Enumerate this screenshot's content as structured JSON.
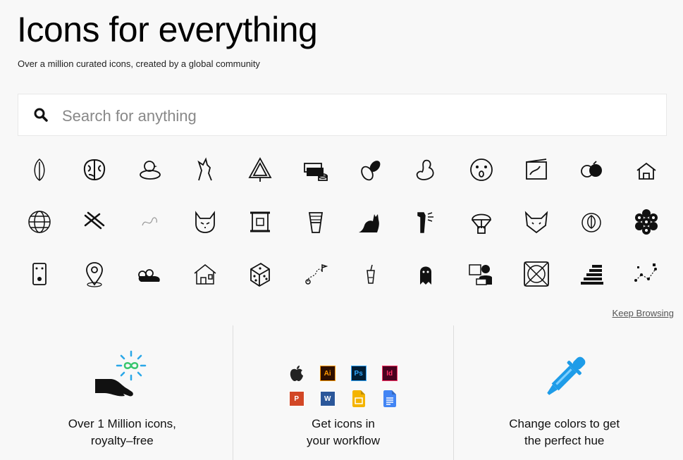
{
  "hero": {
    "title": "Icons for everything",
    "subtitle": "Over a million curated icons, created by a global community"
  },
  "search": {
    "placeholder": "Search for anything",
    "value": ""
  },
  "icon_grid": [
    "leaf-icon",
    "brain-icon",
    "bird-in-nest-icon",
    "wolf-howling-icon",
    "pine-tree-icon",
    "money-stack-icon",
    "cocoa-beans-icon",
    "peanut-icon",
    "surprised-face-icon",
    "drawing-frame-icon",
    "fruit-icon",
    "house-network-icon",
    "globe-icon",
    "nails-icon",
    "scribble-icon",
    "cat-face-icon",
    "scroll-icon",
    "djembe-drum-icon",
    "black-cat-icon",
    "shower-icon",
    "parachute-box-icon",
    "fox-head-icon",
    "leaf-badge-icon",
    "raspberry-icon",
    "effects-pedal-icon",
    "map-pin-icon",
    "roller-skate-icon",
    "house-icon",
    "dice-icon",
    "route-flag-icon",
    "iced-drink-icon",
    "ghost-icon",
    "person-at-laptop-icon",
    "no-signal-square-icon",
    "stairs-icon",
    "dotted-map-icon"
  ],
  "keep_browsing": "Keep Browsing",
  "features": [
    {
      "title": "Over 1 Million icons,\nroyalty–free"
    },
    {
      "title": "Get icons in\nyour workflow"
    },
    {
      "title": "Change colors to get\nthe perfect hue"
    }
  ],
  "apps": [
    {
      "name": "apple-icon",
      "label": "",
      "bg": "",
      "fg": "#222"
    },
    {
      "name": "illustrator-icon",
      "label": "Ai",
      "bg": "#2d0f00",
      "fg": "#ff9a00"
    },
    {
      "name": "photoshop-icon",
      "label": "Ps",
      "bg": "#001d34",
      "fg": "#31a8ff"
    },
    {
      "name": "indesign-icon",
      "label": "Id",
      "bg": "#49021f",
      "fg": "#ff3366"
    },
    {
      "name": "powerpoint-icon",
      "label": "P",
      "bg": "#d24726",
      "fg": "#ffffff"
    },
    {
      "name": "word-icon",
      "label": "W",
      "bg": "#2b579a",
      "fg": "#ffffff"
    },
    {
      "name": "google-slides-icon",
      "label": "",
      "bg": "#f4b400",
      "fg": "#ffffff"
    },
    {
      "name": "google-docs-icon",
      "label": "",
      "bg": "#4285f4",
      "fg": "#ffffff"
    }
  ],
  "colors": {
    "accent_blue": "#1e9ce8",
    "infinity_green": "#39c66d",
    "sparkle_blue": "#2aa7e8"
  }
}
